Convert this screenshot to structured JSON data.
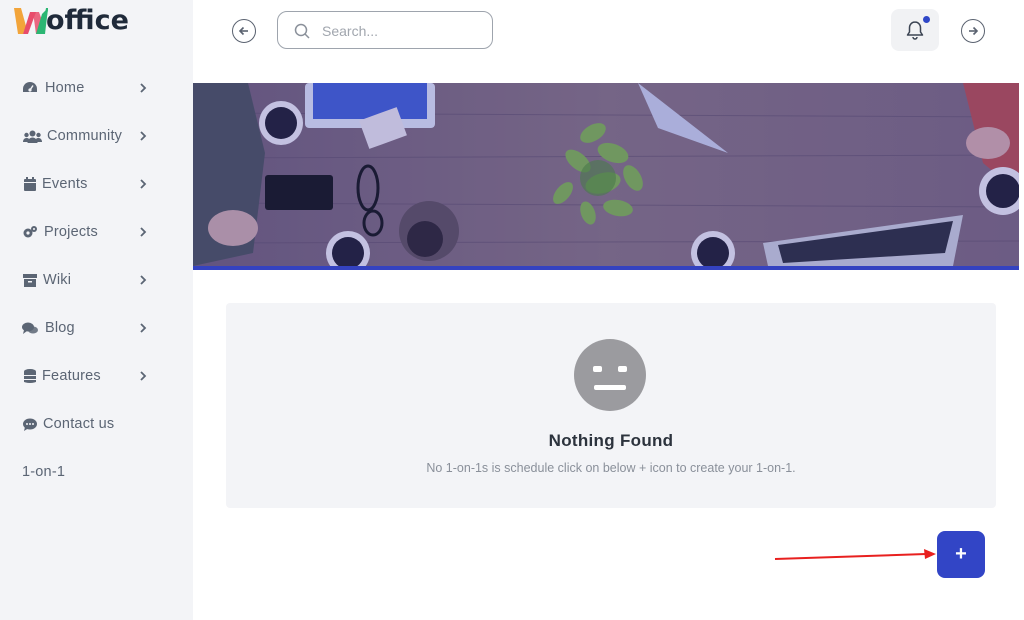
{
  "brand": {
    "logo_initial": "W",
    "logo_rest": "office",
    "colors": [
      "#f2a43a",
      "#e84c6b",
      "#2bb673"
    ]
  },
  "sidebar": {
    "items": [
      {
        "label": "Home",
        "icon": "gauge-icon",
        "chevron": true
      },
      {
        "label": "Community",
        "icon": "users-icon",
        "chevron": true
      },
      {
        "label": "Events",
        "icon": "calendar-icon",
        "chevron": true
      },
      {
        "label": "Projects",
        "icon": "cogs-icon",
        "chevron": true
      },
      {
        "label": "Wiki",
        "icon": "archive-icon",
        "chevron": true
      },
      {
        "label": "Blog",
        "icon": "comments-icon",
        "chevron": true
      },
      {
        "label": "Features",
        "icon": "database-icon",
        "chevron": true
      },
      {
        "label": "Contact us",
        "icon": "comment-dots-icon",
        "chevron": false
      },
      {
        "label": "1-on-1",
        "icon": "",
        "chevron": false
      }
    ]
  },
  "header": {
    "search_placeholder": "Search...",
    "back_icon": "arrow-left-circle-icon",
    "forward_icon": "arrow-right-circle-icon",
    "notification_icon": "bell-icon"
  },
  "empty_state": {
    "title": "Nothing Found",
    "message": "No 1-on-1s is schedule click on below + icon to create your 1-on-1.",
    "icon": "neutral-face-icon"
  },
  "actions": {
    "add_label": "+"
  },
  "colors": {
    "accent": "#3245c6",
    "sidebar_bg": "#f3f4f7",
    "annotation_arrow": "#e8201f"
  }
}
